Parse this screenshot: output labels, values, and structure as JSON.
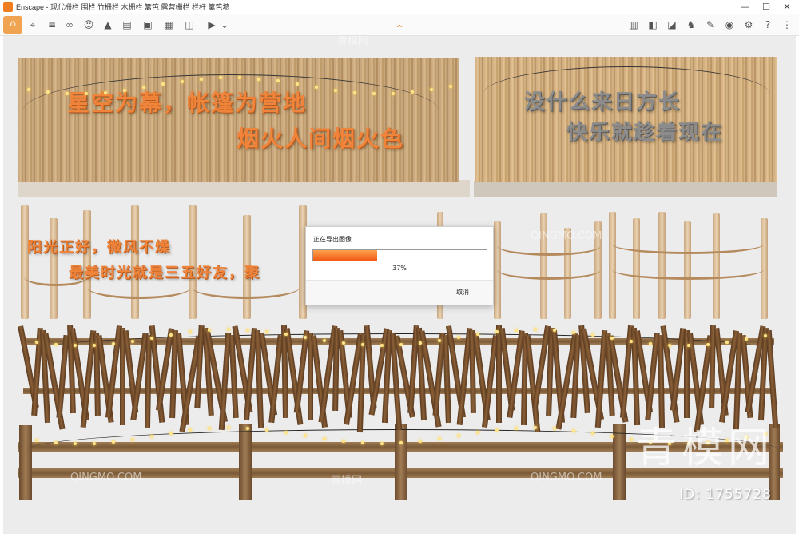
{
  "window": {
    "title": "Enscape - 现代栅栏 围栏 竹栅栏 木栅栏 篱笆 露营栅栏 栏杆 篱笆墙",
    "controls": {
      "minimize": "—",
      "maximize": "☐",
      "close": "✕"
    }
  },
  "toolbar": {
    "icons": [
      "home-icon",
      "location-icon",
      "list-icon",
      "bim-icon",
      "binoculars-icon",
      "person-icon",
      "landscape-icon",
      "cabinet-icon",
      "clapper-icon",
      "screenshot-icon",
      "batch-render-icon",
      "panorama-icon",
      "video-export-icon",
      "settings-dropdown-icon",
      "map-icon",
      "cube-icon",
      "box-icon",
      "asset-library-icon",
      "chat-icon",
      "eye-icon",
      "gear-icon",
      "help-icon"
    ],
    "collapse_icon": "^"
  },
  "scene": {
    "panel1_line1": "星空为幕，帐篷为营地",
    "panel1_line2": "烟火人间烟火色",
    "panel2_line1": "没什么来日方长",
    "panel2_line2": "快乐就趁着现在",
    "panel3_line1": "阳光正好，微风不燥",
    "panel3_line2": "最美时光就是三五好友，聚"
  },
  "dialog": {
    "title": "正在导出图像...",
    "progress": 0.37,
    "progress_text": "37%",
    "cancel_label": "取消"
  },
  "watermarks": {
    "brand_cn": "青模网",
    "brand_en": "QINGMO.COM",
    "id_text": "ID: 1755728"
  },
  "colors": {
    "accent": "#f07d1f",
    "progress": "#f05a14"
  }
}
